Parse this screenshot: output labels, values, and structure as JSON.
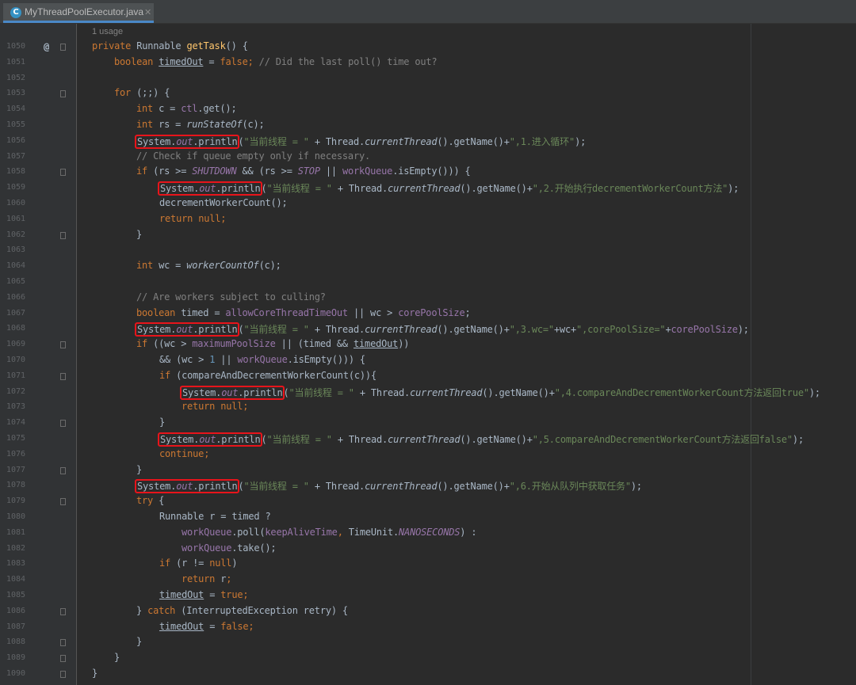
{
  "tab": {
    "title": "MyThreadPoolExecutor.java",
    "icon": "C",
    "close": "✕"
  },
  "editor": {
    "usage_hint": "1 usage",
    "lines": [
      {
        "no": "1050"
      },
      {
        "no": "1051"
      },
      {
        "no": "1052"
      },
      {
        "no": "1053"
      },
      {
        "no": "1054"
      },
      {
        "no": "1055"
      },
      {
        "no": "1056"
      },
      {
        "no": "1057"
      },
      {
        "no": "1058"
      },
      {
        "no": "1059"
      },
      {
        "no": "1060"
      },
      {
        "no": "1061"
      },
      {
        "no": "1062"
      },
      {
        "no": "1063"
      },
      {
        "no": "1064"
      },
      {
        "no": "1065"
      },
      {
        "no": "1066"
      },
      {
        "no": "1067"
      },
      {
        "no": "1068"
      },
      {
        "no": "1069"
      },
      {
        "no": "1070"
      },
      {
        "no": "1071"
      },
      {
        "no": "1072"
      },
      {
        "no": "1073"
      },
      {
        "no": "1074"
      },
      {
        "no": "1075"
      },
      {
        "no": "1076"
      },
      {
        "no": "1077"
      },
      {
        "no": "1078"
      },
      {
        "no": "1079"
      },
      {
        "no": "1080"
      },
      {
        "no": "1081"
      },
      {
        "no": "1082"
      },
      {
        "no": "1083"
      },
      {
        "no": "1084"
      },
      {
        "no": "1085"
      },
      {
        "no": "1086"
      },
      {
        "no": "1087"
      },
      {
        "no": "1088"
      },
      {
        "no": "1089"
      },
      {
        "no": "1090"
      }
    ],
    "code": {
      "l1050": {
        "private": "private ",
        "type": "Runnable ",
        "name": "getTask",
        "rest": "() {"
      },
      "l1051": {
        "kw": "boolean ",
        "var": "timedOut",
        "eq": " = ",
        "false": "false",
        "semi": "; ",
        "comment": "// Did the last poll() time out?"
      },
      "l1053": {
        "for": "for ",
        "rest": "(;;) {"
      },
      "l1054": {
        "int": "int ",
        "a": "c = ",
        "ctl": "ctl",
        "b": ".get();"
      },
      "l1055": {
        "int": "int ",
        "a": "rs = ",
        "m": "runStateOf",
        "b": "(c);"
      },
      "l1057": {
        "comment": "// Check if queue empty only if necessary."
      },
      "l1058": {
        "if": "if ",
        "a": "(rs >= ",
        "shutdown": "SHUTDOWN",
        "b": " && (rs >= ",
        "stop": "STOP",
        "c": " || ",
        "wq": "workQueue",
        "d": ".isEmpty())) {"
      },
      "l1060": {
        "a": "decrementWorkerCount();"
      },
      "l1061": {
        "return": "return ",
        "null": "null",
        "semi": ";"
      },
      "l1062": {
        "a": "}"
      },
      "l1064": {
        "int": "int ",
        "a": "wc = ",
        "m": "workerCountOf",
        "b": "(c);"
      },
      "l1066": {
        "comment": "// Are workers subject to culling?"
      },
      "l1067": {
        "kw": "boolean ",
        "a": "timed = ",
        "f": "allowCoreThreadTimeOut",
        "b": " || wc > ",
        "g": "corePoolSize",
        "c": ";"
      },
      "l1069": {
        "if": "if ",
        "a": "((wc > ",
        "f": "maximumPoolSize",
        "b": " || (timed && ",
        "v": "timedOut",
        "c": "))"
      },
      "l1070": {
        "a": "&& (wc > ",
        "n": "1",
        "b": " || ",
        "wq": "workQueue",
        "c": ".isEmpty())) {"
      },
      "l1071": {
        "if": "if ",
        "a": "(compareAndDecrementWorkerCount(c)){"
      },
      "l1073": {
        "return": "return ",
        "null": "null",
        "semi": ";"
      },
      "l1074": {
        "a": "}"
      },
      "l1076": {
        "cont": "continue",
        "semi": ";"
      },
      "l1077": {
        "a": "}"
      },
      "l1079": {
        "try": "try ",
        "a": "{"
      },
      "l1080": {
        "a": "Runnable r = timed ?"
      },
      "l1081": {
        "wq": "workQueue",
        "a": ".poll(",
        "f": "keepAliveTime",
        "comma": ", ",
        "b": "TimeUnit.",
        "ns": "NANOSECONDS",
        "c": ") :"
      },
      "l1082": {
        "wq": "workQueue",
        "a": ".take();"
      },
      "l1083": {
        "if": "if ",
        "a": "(r != ",
        "null": "null",
        "b": ")"
      },
      "l1084": {
        "return": "return ",
        "a": "r",
        "semi": ";"
      },
      "l1085": {
        "v": "timedOut",
        "a": " = ",
        "true": "true",
        "semi": ";"
      },
      "l1086": {
        "a": "} ",
        "catch": "catch ",
        "b": "(InterruptedException retry) {"
      },
      "l1087": {
        "v": "timedOut",
        "a": " = ",
        "false": "false",
        "semi": ";"
      },
      "l1088": {
        "a": "}"
      },
      "l1089": {
        "a": "}"
      },
      "l1090": {
        "a": "}"
      }
    },
    "prints": {
      "sys_a": "System.",
      "sys_out": "out",
      "sys_b": ".println",
      "paren": "(",
      "prefix": "\"当前线程 = \"",
      "plus_thread": " + Thread.",
      "current_thread": "currentThread",
      "get_name": "().getName()+",
      "end": ");",
      "p1056": "\",1.进入循环\"",
      "p1059": "\",2.开始执行decrementWorkerCount方法\"",
      "p1068_a": "\",3.wc=\"",
      "p1068_b": "+wc+",
      "p1068_c": "\",corePoolSize=\"",
      "p1068_d": "+",
      "p1068_e": "corePoolSize",
      "p1072": "\",4.compareAndDecrementWorkerCount方法返回true\"",
      "p1075": "\",5.compareAndDecrementWorkerCount方法返回false\"",
      "p1078": "\",6.开始从队列中获取任务\""
    },
    "gutter_marker": "@"
  },
  "colors": {
    "background": "#2b2b2b",
    "gutter": "#313335",
    "keyword": "#cc7832",
    "string": "#6a8759",
    "comment": "#808080",
    "field": "#9876aa",
    "method": "#ffc66d",
    "highlight_box": "#e8141b"
  }
}
